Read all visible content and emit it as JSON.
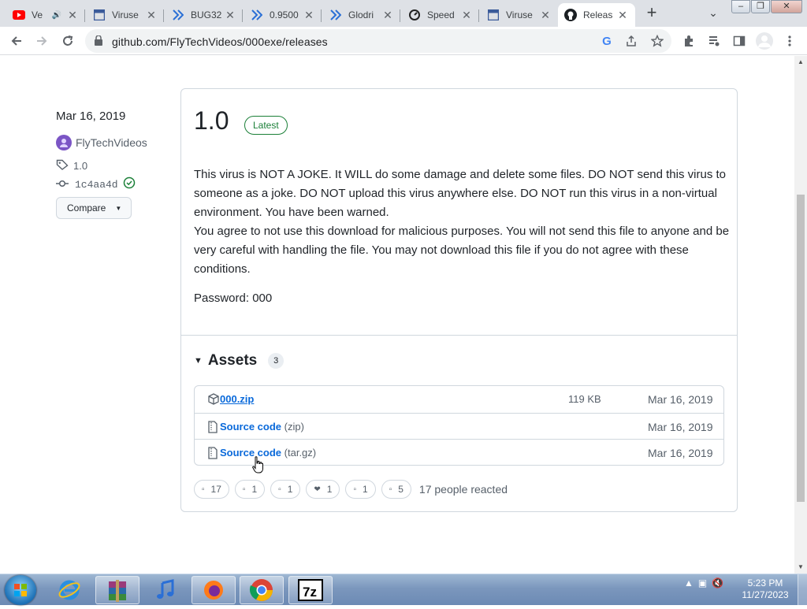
{
  "browser": {
    "tabs": [
      {
        "title": "Ve",
        "icon": "youtube-icon",
        "audio": true
      },
      {
        "title": "Viruse",
        "icon": "page-icon"
      },
      {
        "title": "BUG32",
        "icon": "chevron-site-icon"
      },
      {
        "title": "0.9500",
        "icon": "chevron-site-icon"
      },
      {
        "title": "Glodri",
        "icon": "chevron-site-icon"
      },
      {
        "title": "Speed",
        "icon": "speed-icon"
      },
      {
        "title": "Viruse",
        "icon": "page-icon"
      },
      {
        "title": "Releas",
        "icon": "github-icon",
        "active": true
      }
    ],
    "url": "github.com/FlyTechVideos/000exe/releases"
  },
  "release": {
    "date": "Mar 16, 2019",
    "author": "FlyTechVideos",
    "tag": "1.0",
    "commit": "1c4aa4d",
    "compare_label": "Compare",
    "version": "1.0",
    "badge": "Latest",
    "body_p1": "This virus is NOT A JOKE. It WILL do some damage and delete some files. DO NOT send this virus to someone as a joke. DO NOT upload this virus anywhere else. DO NOT run this virus in a non-virtual environment. You have been warned.",
    "body_p2": "You agree to not use this download for malicious purposes. You will not send this file to anyone and be very careful with handling the file. You may not download this file if you do not agree with these conditions.",
    "password": "Password: 000",
    "assets_title": "Assets",
    "assets_count": "3",
    "assets": [
      {
        "name": "000.zip",
        "sub": "",
        "size": "119 KB",
        "date": "Mar 16, 2019"
      },
      {
        "name": "Source code",
        "sub": "(zip)",
        "size": "",
        "date": "Mar 16, 2019"
      },
      {
        "name": "Source code",
        "sub": "(tar.gz)",
        "size": "",
        "date": "Mar 16, 2019"
      }
    ],
    "reactions": [
      {
        "emoji": "▫",
        "count": "17"
      },
      {
        "emoji": "▫",
        "count": "1"
      },
      {
        "emoji": "▫",
        "count": "1"
      },
      {
        "emoji": "❤",
        "count": "1"
      },
      {
        "emoji": "▫",
        "count": "1"
      },
      {
        "emoji": "▫",
        "count": "5"
      }
    ],
    "reacted_text": "17 people reacted"
  },
  "taskbar": {
    "time": "5:23 PM",
    "date": "11/27/2023"
  },
  "colors": {
    "link": "#0969da",
    "latest": "#1a7f37",
    "taskbar": "#7b97bd"
  }
}
